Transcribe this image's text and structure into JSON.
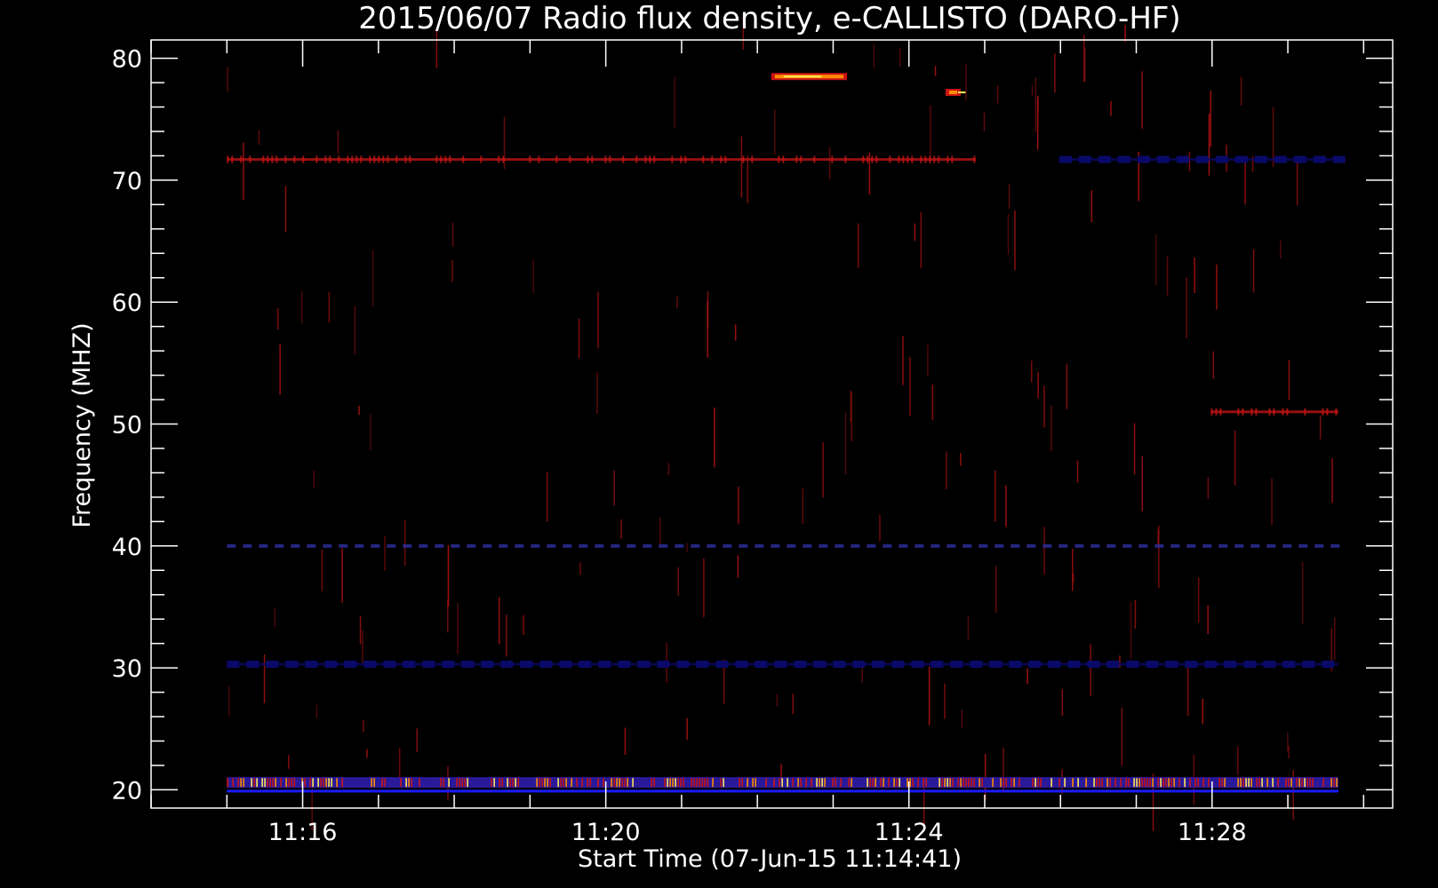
{
  "chart_data": {
    "type": "heatmap",
    "title": "2015/06/07  Radio flux density, e-CALLISTO (DARO-HF)",
    "xlabel": "Start Time (07-Jun-15 11:14:41)",
    "ylabel": "Frequency (MHZ)",
    "x_unit": "minutes",
    "xlim": [
      -0.6833,
      15.7
    ],
    "ylim": [
      81.5,
      18.5
    ],
    "data_x_range": [
      0.3167,
      14.9833
    ],
    "data_y_range": [
      20,
      80
    ],
    "x_ticks": [
      {
        "label": "11:16",
        "value": 1.3167
      },
      {
        "label": "11:20",
        "value": 5.3167
      },
      {
        "label": "11:24",
        "value": 9.3167
      },
      {
        "label": "11:28",
        "value": 13.3167
      }
    ],
    "x_minor_step": 1,
    "y_ticks": [
      20,
      30,
      40,
      50,
      60,
      70,
      80
    ],
    "y_minor_step": 2,
    "colors": {
      "background": "#000000",
      "axes": "#ffffff",
      "base": "#2222f0",
      "dark": "#0a0a6a",
      "hot_red": "#c81414",
      "hot_orange": "#ff8c00",
      "hot_yellow": "#ffe65a"
    },
    "features": [
      {
        "kind": "band",
        "y": 20.6,
        "x0": 0.3167,
        "x1": 14.9833,
        "intensity": "hot"
      },
      {
        "kind": "band",
        "y": 30.3,
        "x0": 0.3167,
        "x1": 14.9833,
        "intensity": "dark"
      },
      {
        "kind": "band",
        "y": 40.0,
        "x0": 0.3167,
        "x1": 14.9833,
        "intensity": "dim"
      },
      {
        "kind": "band",
        "y": 71.7,
        "x0": 0.3167,
        "x1": 10.2,
        "intensity": "red"
      },
      {
        "kind": "band",
        "y": 71.7,
        "x0": 11.3,
        "x1": 14.9833,
        "intensity": "dark"
      },
      {
        "kind": "band",
        "y": 51.0,
        "x0": 13.3,
        "x1": 14.9833,
        "intensity": "red"
      },
      {
        "kind": "burst",
        "y": 78.5,
        "x0": 7.5,
        "x1": 8.5,
        "intensity": "hot"
      },
      {
        "kind": "burst",
        "y": 77.2,
        "x0": 9.8,
        "x1": 10.0,
        "intensity": "hot"
      }
    ]
  }
}
